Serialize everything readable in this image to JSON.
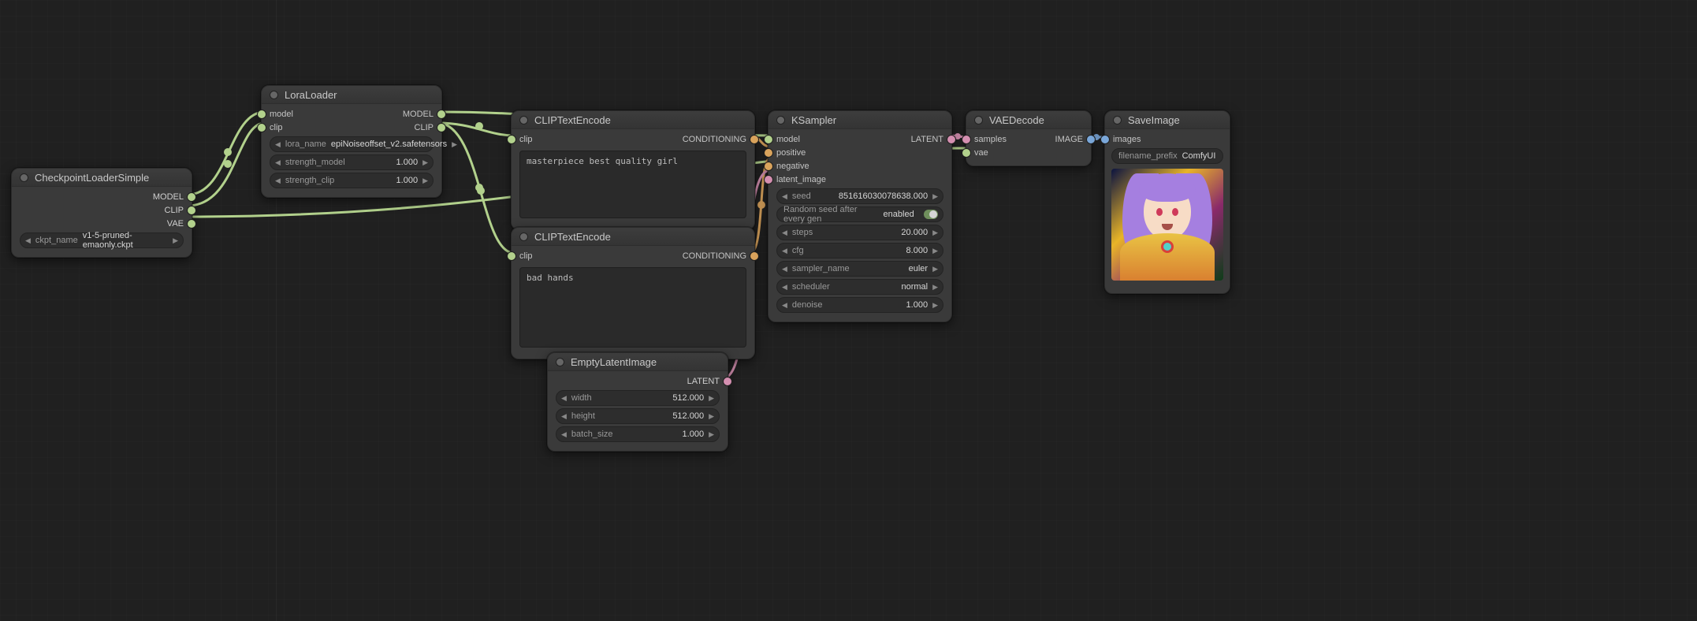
{
  "nodes": {
    "checkpoint": {
      "title": "CheckpointLoaderSimple",
      "outputs": {
        "model": "MODEL",
        "clip": "CLIP",
        "vae": "VAE"
      },
      "widgets": {
        "ckpt_name": {
          "label": "ckpt_name",
          "value": "v1-5-pruned-emaonly.ckpt"
        }
      }
    },
    "lora": {
      "title": "LoraLoader",
      "inputs": {
        "model": "model",
        "clip": "clip"
      },
      "outputs": {
        "model": "MODEL",
        "clip": "CLIP"
      },
      "widgets": {
        "lora_name": {
          "label": "lora_name",
          "value": "epiNoiseoffset_v2.safetensors"
        },
        "strength_model": {
          "label": "strength_model",
          "value": "1.000"
        },
        "strength_clip": {
          "label": "strength_clip",
          "value": "1.000"
        }
      }
    },
    "clip_pos": {
      "title": "CLIPTextEncode",
      "inputs": {
        "clip": "clip"
      },
      "outputs": {
        "conditioning": "CONDITIONING"
      },
      "text": "masterpiece best quality girl"
    },
    "clip_neg": {
      "title": "CLIPTextEncode",
      "inputs": {
        "clip": "clip"
      },
      "outputs": {
        "conditioning": "CONDITIONING"
      },
      "text": "bad hands"
    },
    "empty_latent": {
      "title": "EmptyLatentImage",
      "outputs": {
        "latent": "LATENT"
      },
      "widgets": {
        "width": {
          "label": "width",
          "value": "512.000"
        },
        "height": {
          "label": "height",
          "value": "512.000"
        },
        "batch_size": {
          "label": "batch_size",
          "value": "1.000"
        }
      }
    },
    "ksampler": {
      "title": "KSampler",
      "inputs": {
        "model": "model",
        "positive": "positive",
        "negative": "negative",
        "latent_image": "latent_image"
      },
      "outputs": {
        "latent": "LATENT"
      },
      "widgets": {
        "seed": {
          "label": "seed",
          "value": "851616030078638.000"
        },
        "random_seed": {
          "label": "Random seed after every gen",
          "value": "enabled"
        },
        "steps": {
          "label": "steps",
          "value": "20.000"
        },
        "cfg": {
          "label": "cfg",
          "value": "8.000"
        },
        "sampler_name": {
          "label": "sampler_name",
          "value": "euler"
        },
        "scheduler": {
          "label": "scheduler",
          "value": "normal"
        },
        "denoise": {
          "label": "denoise",
          "value": "1.000"
        }
      }
    },
    "vae_decode": {
      "title": "VAEDecode",
      "inputs": {
        "samples": "samples",
        "vae": "vae"
      },
      "outputs": {
        "image": "IMAGE"
      }
    },
    "save_image": {
      "title": "SaveImage",
      "inputs": {
        "images": "images"
      },
      "widgets": {
        "filename_prefix": {
          "label": "filename_prefix",
          "value": "ComfyUI"
        }
      }
    }
  }
}
